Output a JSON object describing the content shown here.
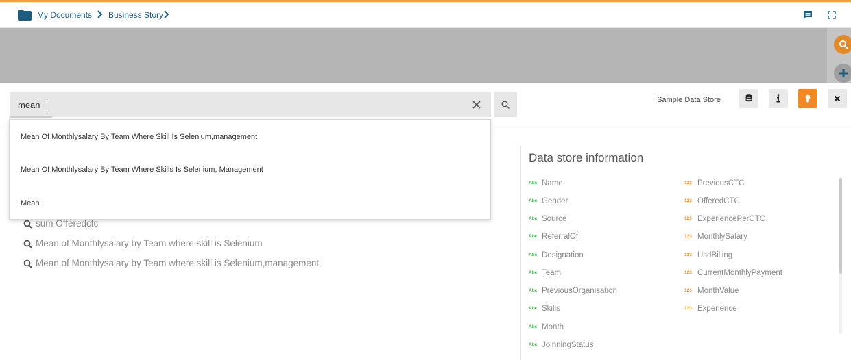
{
  "breadcrumb": {
    "items": [
      "My Documents",
      "Business Story"
    ]
  },
  "search": {
    "value": "mean",
    "suggestions": [
      "Mean Of Monthlysalary By Team Where Skill Is Selenium,management",
      "Mean Of Monthlysalary By Team Where Skills Is Selenium, Management",
      "Mean"
    ]
  },
  "history": [
    "sum Offeredctc",
    "Mean of Monthlysalary by Team where skill is Selenium",
    "Mean of Monthlysalary by Team where skill is Selenium,management"
  ],
  "toolbar": {
    "store_label": "Sample Data Store"
  },
  "datastore": {
    "title": "Data store information",
    "text_badge": "Abc",
    "num_badge": "123",
    "text_fields": [
      "Name",
      "Gender",
      "Source",
      "ReferralOf",
      "Designation",
      "Team",
      "PreviousOrganisation",
      "Skills",
      "Month",
      "JoinningStatus"
    ],
    "numeric_fields": [
      "PreviousCTC",
      "OfferedCTC",
      "ExperiencePerCTC",
      "MonthlySalary",
      "UsdBilling",
      "CurrentMonthlyPayment",
      "MonthValue",
      "Experience"
    ]
  },
  "colors": {
    "accent": "#f08a24",
    "top_line": "#e8a33d",
    "breadcrumb": "#1f5d80",
    "text_badge": "#4caf50",
    "num_badge": "#f08a24"
  },
  "icons": [
    "folder-icon",
    "chevron-right-icon",
    "comment-icon",
    "fullscreen-icon",
    "search-icon",
    "plus-icon",
    "close-icon",
    "database-icon",
    "info-icon",
    "lightbulb-icon"
  ]
}
